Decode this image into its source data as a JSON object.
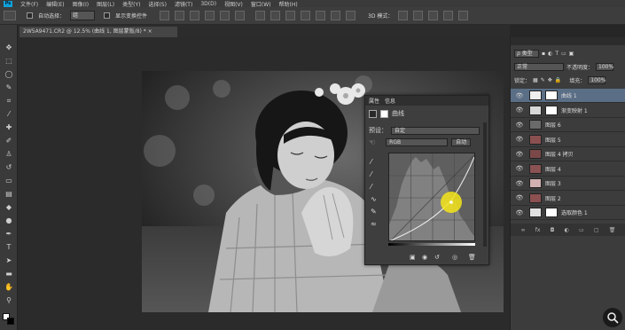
{
  "menu": {
    "logo": "Ps",
    "items": [
      "文件(F)",
      "编辑(E)",
      "图像(I)",
      "图层(L)",
      "类型(Y)",
      "选择(S)",
      "滤镜(T)",
      "3D(D)",
      "视图(V)",
      "窗口(W)",
      "帮助(H)"
    ]
  },
  "options": {
    "auto_select_label": "自动选择：",
    "auto_select_value": "组",
    "show_transform_label": "显示变换控件",
    "mode_3d_label": "3D 模式："
  },
  "document_tab": "2W5A9471.CR2 @ 12.5% (曲线 1, 图层蒙版/8) * ×",
  "properties": {
    "tabs": [
      "属性",
      "信息"
    ],
    "panel_title": "曲线",
    "preset_label": "预设：",
    "preset_value": "自定",
    "channel_value": "RGB",
    "auto_button": "自动"
  },
  "layers": {
    "filter_label": "ρ 类型",
    "blend_mode": "正常",
    "opacity_label": "不透明度：",
    "opacity_value": "100%",
    "lock_label": "锁定：",
    "fill_label": "填充：",
    "fill_value": "100%",
    "items": [
      {
        "name": "曲线 1",
        "active": true,
        "thumb": "#eeeeee",
        "mask": true
      },
      {
        "name": "渐变映射 1",
        "active": false,
        "thumb": "#d8d8d8",
        "mask": true
      },
      {
        "name": "图层 6",
        "active": false,
        "thumb": "#6a6a6a",
        "mask": false
      },
      {
        "name": "图层 5",
        "active": false,
        "thumb": "#8a5050",
        "mask": false
      },
      {
        "name": "图层 4 拷贝",
        "active": false,
        "thumb": "#7a4848",
        "mask": false
      },
      {
        "name": "图层 4",
        "active": false,
        "thumb": "#8a5252",
        "mask": false
      },
      {
        "name": "图层 3",
        "active": false,
        "thumb": "#d0b0b0",
        "mask": false
      },
      {
        "name": "图层 2",
        "active": false,
        "thumb": "#8c5050",
        "mask": false
      },
      {
        "name": "选取颜色 1",
        "active": false,
        "thumb": "#e0e0e0",
        "mask": true
      }
    ],
    "footer_icons": [
      "link-icon",
      "fx-icon",
      "mask-icon",
      "adjustment-icon",
      "folder-icon",
      "new-layer-icon",
      "trash-icon"
    ]
  },
  "colors": {
    "accent_active": "#5a6e86",
    "cursor_highlight": "#f5e51a"
  }
}
